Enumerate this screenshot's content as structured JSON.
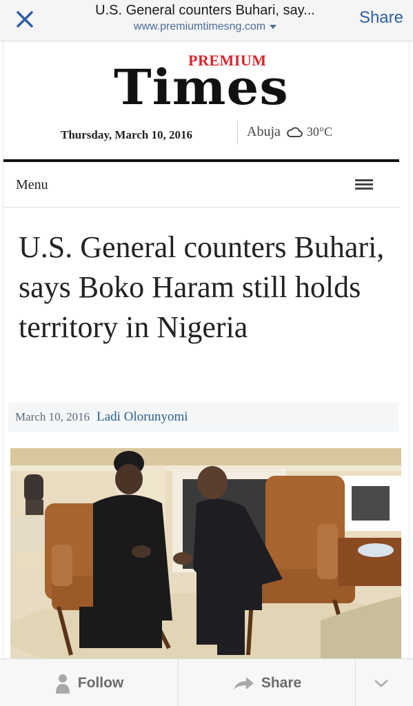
{
  "browser": {
    "title": "U.S. General counters Buhari, say...",
    "url": "www.premiumtimesng.com",
    "share_label": "Share",
    "close_icon": "close-icon"
  },
  "masthead": {
    "logo_top": "PREMIUM",
    "logo_main": "Times",
    "date": "Thursday, March 10, 2016",
    "city": "Abuja",
    "temperature": "30°C",
    "weather_icon": "cloud-icon"
  },
  "nav": {
    "menu_label": "Menu",
    "menu_icon": "hamburger-icon"
  },
  "article": {
    "headline": "U.S. General counters Buhari, says Boko Haram still holds territory in Nigeria",
    "date": "March 10, 2016",
    "author": "Ladi Olorunyomi"
  },
  "toolbar": {
    "follow_label": "Follow",
    "share_label": "Share",
    "follow_icon": "person-icon",
    "share_icon": "share-arrow-icon",
    "more_icon": "chevron-down-icon"
  },
  "colors": {
    "brand_red": "#d8262c",
    "link_blue": "#2a5d8f",
    "ios_blue": "#2f5ea8"
  }
}
